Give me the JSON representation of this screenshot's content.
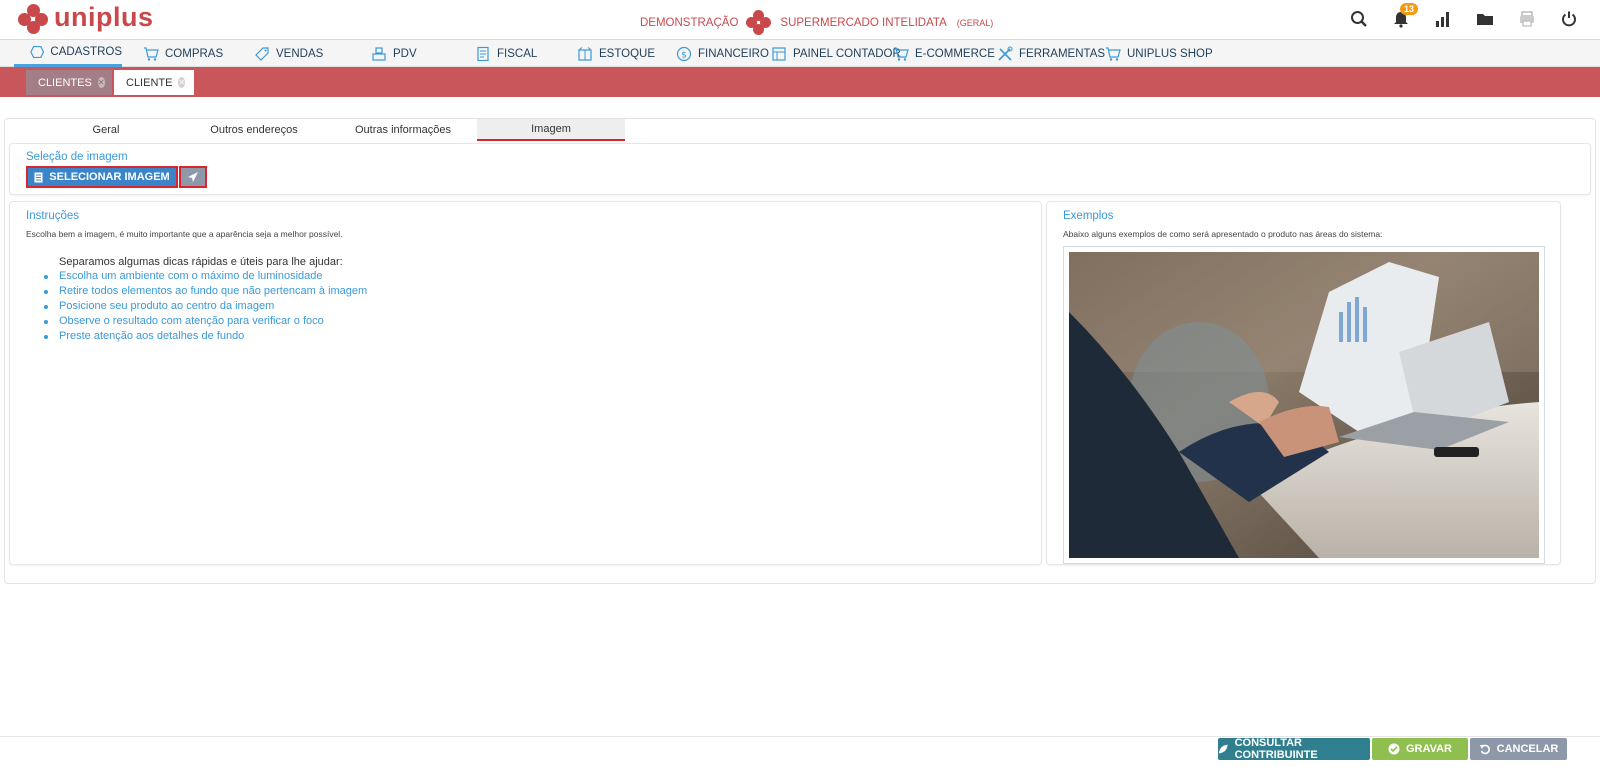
{
  "app": {
    "brand": "uniplus"
  },
  "company": {
    "prefix": "DEMONSTRAÇÃO",
    "name": "SUPERMERCADO INTELIDATA",
    "unit": "(GERAL)"
  },
  "topbar": {
    "notifications_count": "13"
  },
  "menu": [
    {
      "label": "CADASTROS",
      "icon": "hexagon-icon"
    },
    {
      "label": "COMPRAS",
      "icon": "cart-icon"
    },
    {
      "label": "VENDAS",
      "icon": "tag-icon"
    },
    {
      "label": "PDV",
      "icon": "register-icon"
    },
    {
      "label": "FISCAL",
      "icon": "document-icon"
    },
    {
      "label": "ESTOQUE",
      "icon": "box-icon"
    },
    {
      "label": "FINANCEIRO",
      "icon": "dollar-icon"
    },
    {
      "label": "PAINEL CONTADOR",
      "icon": "ledger-icon"
    },
    {
      "label": "E-COMMERCE",
      "icon": "cart-icon"
    },
    {
      "label": "FERRAMENTAS",
      "icon": "tools-icon"
    },
    {
      "label": "UNIPLUS SHOP",
      "icon": "cart-icon"
    }
  ],
  "doc_tabs": {
    "list_tab": "CLIENTES",
    "edit_tab": "CLIENTE"
  },
  "subtabs": [
    "Geral",
    "Outros endereços",
    "Outras informações",
    "Imagem"
  ],
  "image_selection": {
    "title": "Seleção de imagem",
    "select_button": "SELECIONAR IMAGEM"
  },
  "instructions": {
    "title": "Instruções",
    "intro": "Escolha bem a imagem, é muito importante que a aparência seja a melhor possível.",
    "tips_head": "Separamos algumas dicas rápidas e úteis para lhe ajudar:",
    "tips": [
      "Escolha um ambiente com o máximo de luminosidade",
      "Retire todos elementos ao fundo que não pertencam à imagem",
      "Posicione seu produto ao centro da imagem",
      "Observe o resultado com atenção para verificar o foco",
      "Preste atenção aos detalhes de fundo"
    ]
  },
  "examples": {
    "title": "Exemplos",
    "description": "Abaixo alguns exemplos de como será apresentado o produto nas áreas do sistema:"
  },
  "footer": {
    "consult": "CONSULTAR CONTRIBUINTE",
    "save": "GRAVAR",
    "cancel": "CANCELAR"
  },
  "colors": {
    "brand_red": "#c9484c",
    "accent_blue": "#3a9ad9",
    "consult": "#2f7f8f",
    "save": "#8fbf4f",
    "cancel": "#8d98a8"
  }
}
